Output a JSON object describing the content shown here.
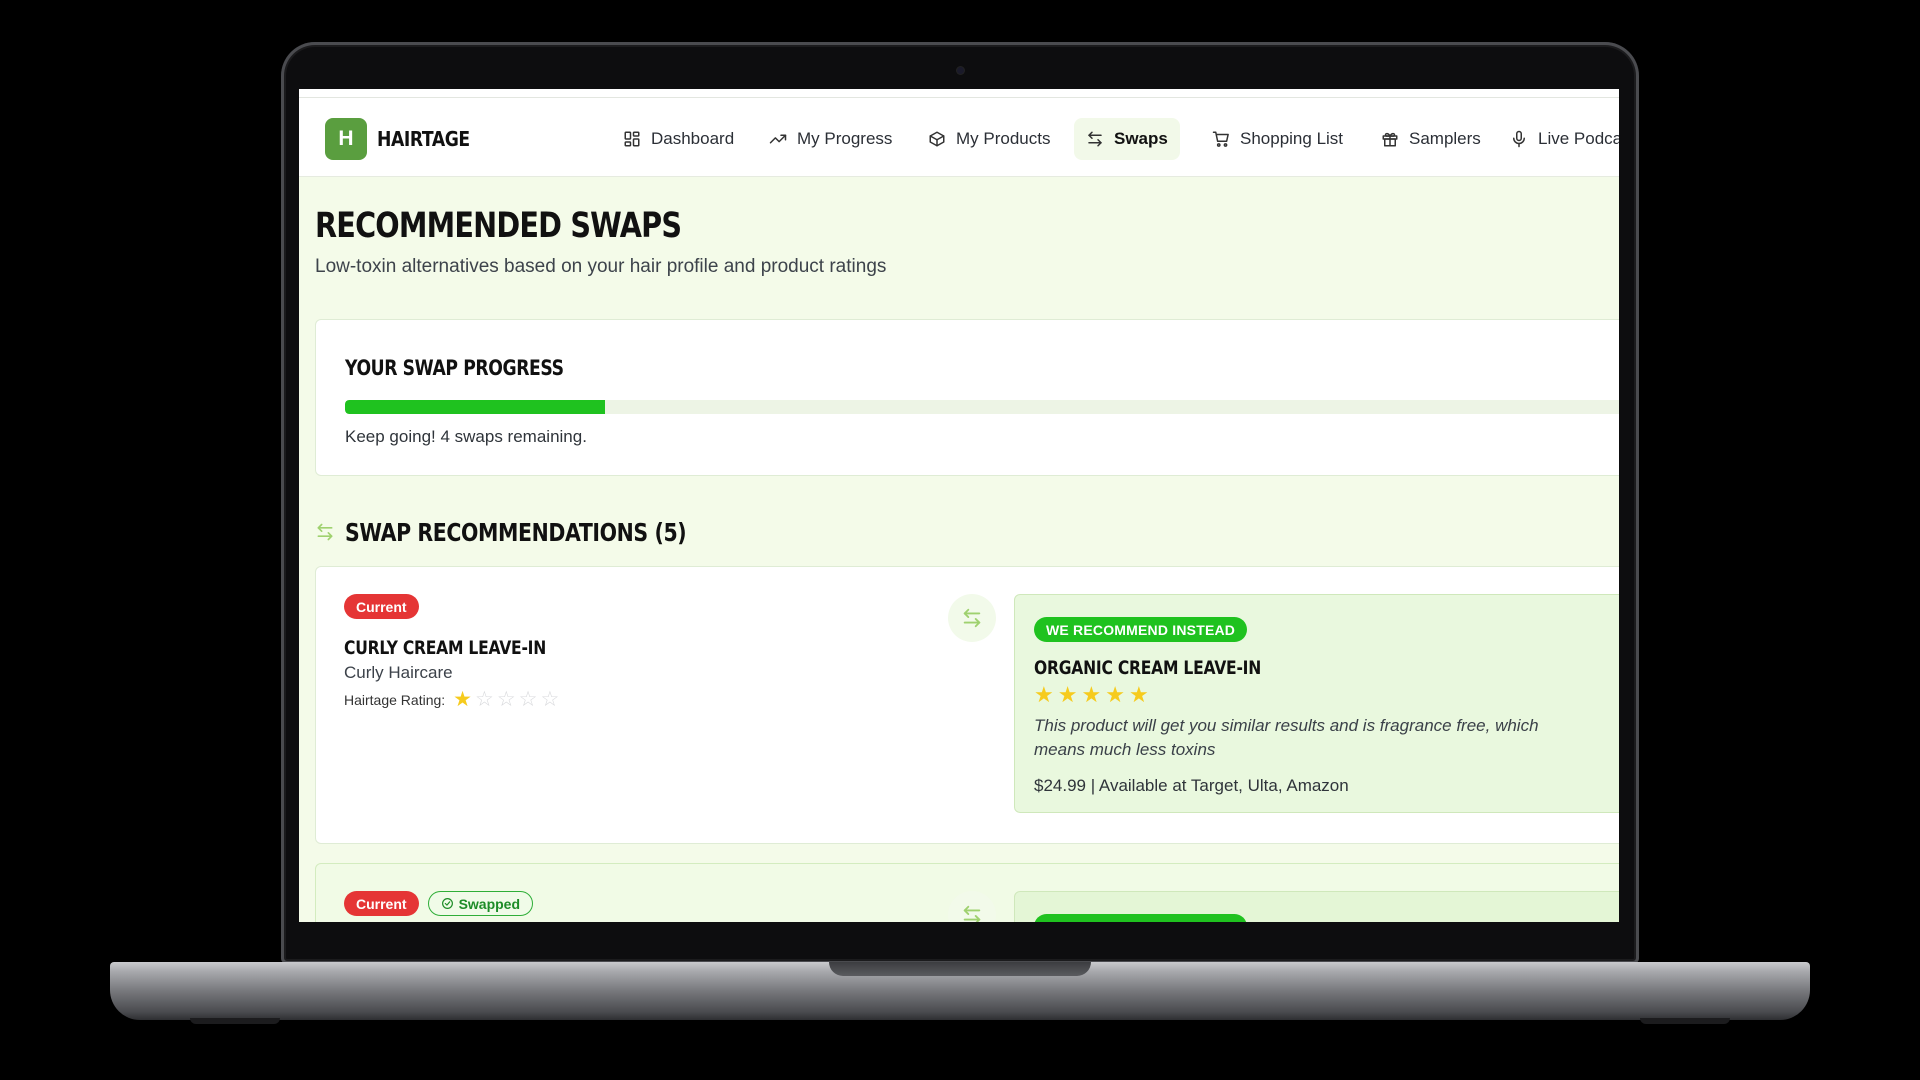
{
  "app": {
    "logo_letter": "H",
    "logo_text": "HAIRTAGE",
    "brand_color": "#5a9e3f",
    "accent_green": "#1fc21f",
    "current_red": "#e53535"
  },
  "nav": {
    "items": [
      {
        "label": "Dashboard",
        "icon": "dashboard-icon",
        "active": false
      },
      {
        "label": "My Progress",
        "icon": "trending-up-icon",
        "active": false
      },
      {
        "label": "My Products",
        "icon": "package-icon",
        "active": false
      },
      {
        "label": "Swaps",
        "icon": "swap-arrows-icon",
        "active": true
      },
      {
        "label": "Shopping List",
        "icon": "cart-icon",
        "active": false
      },
      {
        "label": "Samplers",
        "icon": "gift-icon",
        "active": false
      },
      {
        "label": "Live Podca",
        "icon": "microphone-icon",
        "active": false
      }
    ]
  },
  "page": {
    "title": "RECOMMENDED SWAPS",
    "subtitle": "Low-toxin alternatives based on your hair profile and product ratings"
  },
  "progress": {
    "title": "YOUR SWAP PROGRESS",
    "fraction_complete": 0.2,
    "message": "Keep going! 4 swaps remaining."
  },
  "recommendations": {
    "heading": "SWAP RECOMMENDATIONS (5)",
    "cards": [
      {
        "current_badge": "Current",
        "swapped_badge": "",
        "current_name": "CURLY CREAM LEAVE-IN",
        "current_brand": "Curly Haircare",
        "rating_label": "Hairtage Rating:",
        "current_rating": 1,
        "rating_max": 5,
        "rec_badge": "WE RECOMMEND INSTEAD",
        "rec_name": "ORGANIC CREAM LEAVE-IN",
        "rec_rating": 5,
        "rec_description": "This product will get you similar results and is fragrance free, which means much less toxins",
        "rec_price_line": "$24.99 | Available at Target, Ulta, Amazon"
      },
      {
        "current_badge": "Current",
        "swapped_badge": "Swapped",
        "rec_badge": "WE RECOMMEND INSTEAD"
      }
    ]
  }
}
